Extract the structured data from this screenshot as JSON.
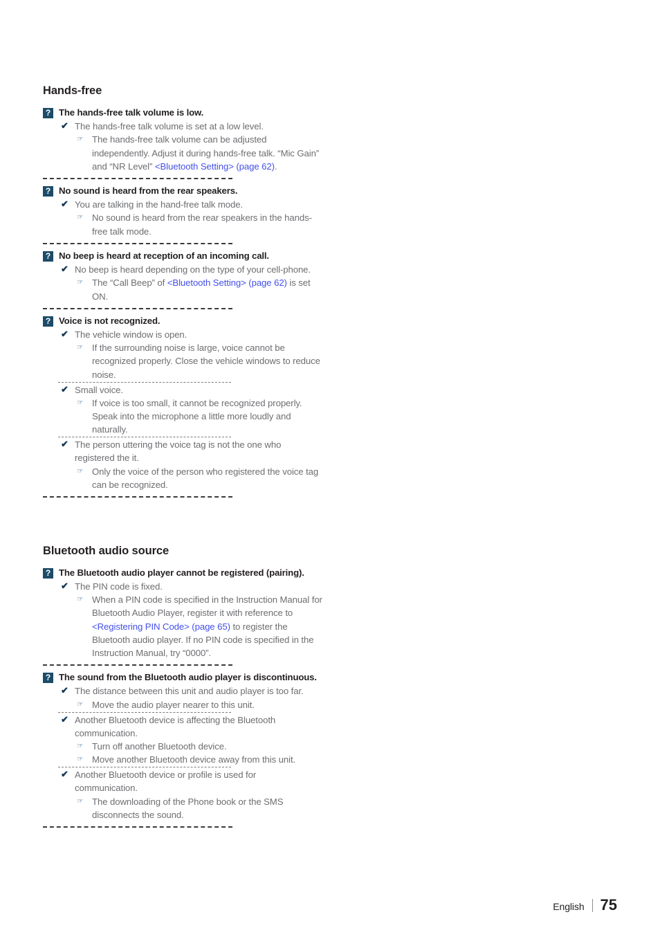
{
  "page": {
    "footer_language": "English",
    "footer_page_number": "75",
    "colors": {
      "badge_bg": "#1c4c68",
      "heading": "#231f20",
      "body": "#6d6e71",
      "link": "#4450e8",
      "check_icon": "#12395a"
    }
  },
  "icons": {
    "question_badge": "?",
    "check": "✔",
    "pointer": "☞"
  },
  "sections": [
    {
      "heading": "Hands-free",
      "items": [
        {
          "question": "The hands-free talk volume is low.",
          "causes": [
            {
              "text": "The hands-free talk volume is set at a low level.",
              "solutions": [
                {
                  "parts": [
                    {
                      "type": "text",
                      "value": "The hands-free talk volume can be adjusted independently. Adjust it during hands-free talk. “Mic Gain” and “NR Level” "
                    },
                    {
                      "type": "link",
                      "value": "<Bluetooth Setting> (page 62)"
                    },
                    {
                      "type": "text",
                      "value": "."
                    }
                  ]
                }
              ]
            }
          ]
        },
        {
          "question": "No sound is heard from the rear speakers.",
          "causes": [
            {
              "text": "You are talking in the hand-free talk mode.",
              "solutions": [
                {
                  "parts": [
                    {
                      "type": "text",
                      "value": "No sound is heard from the rear speakers in the hands-free talk mode."
                    }
                  ]
                }
              ]
            }
          ]
        },
        {
          "question": "No beep is heard at reception of an incoming call.",
          "causes": [
            {
              "text": "No beep is heard depending on the type of your cell-phone.",
              "solutions": [
                {
                  "parts": [
                    {
                      "type": "text",
                      "value": "The “Call Beep” of "
                    },
                    {
                      "type": "link",
                      "value": "<Bluetooth Setting> (page 62)"
                    },
                    {
                      "type": "text",
                      "value": " is set ON."
                    }
                  ]
                }
              ]
            }
          ]
        },
        {
          "question": "Voice is not recognized.",
          "causes": [
            {
              "text": "The vehicle window is open.",
              "solutions": [
                {
                  "parts": [
                    {
                      "type": "text",
                      "value": "If the surrounding noise is large, voice cannot be recognized properly. Close the vehicle windows to reduce noise."
                    }
                  ]
                }
              ]
            },
            {
              "text": "Small voice.",
              "solutions": [
                {
                  "parts": [
                    {
                      "type": "text",
                      "value": "If voice is too small, it cannot be recognized properly. Speak into the microphone a little more loudly and naturally."
                    }
                  ]
                }
              ]
            },
            {
              "text": "The person uttering the voice tag is not the one who registered the it.",
              "solutions": [
                {
                  "parts": [
                    {
                      "type": "text",
                      "value": "Only the voice of the person who registered the voice tag can be recognized."
                    }
                  ]
                }
              ]
            }
          ]
        }
      ]
    },
    {
      "heading": "Bluetooth audio source",
      "items": [
        {
          "question": "The Bluetooth audio player cannot be registered (pairing).",
          "causes": [
            {
              "text": "The PIN code is fixed.",
              "solutions": [
                {
                  "parts": [
                    {
                      "type": "text",
                      "value": "When a PIN code is specified in the Instruction Manual for Bluetooth Audio Player, register it with reference to "
                    },
                    {
                      "type": "link",
                      "value": "<Registering PIN Code> (page 65)"
                    },
                    {
                      "type": "text",
                      "value": " to register the Bluetooth audio player. If no PIN code is specified in the Instruction Manual, try “0000”."
                    }
                  ]
                }
              ]
            }
          ]
        },
        {
          "question": "The sound from the Bluetooth audio player is discontinuous.",
          "causes": [
            {
              "text": "The distance between this unit and audio player is too far.",
              "solutions": [
                {
                  "parts": [
                    {
                      "type": "text",
                      "value": "Move the audio player nearer to this unit."
                    }
                  ]
                }
              ]
            },
            {
              "text": "Another Bluetooth device is affecting the Bluetooth communication.",
              "solutions": [
                {
                  "parts": [
                    {
                      "type": "text",
                      "value": "Turn off another Bluetooth device."
                    }
                  ]
                },
                {
                  "parts": [
                    {
                      "type": "text",
                      "value": "Move another Bluetooth device away from this unit."
                    }
                  ]
                }
              ]
            },
            {
              "text": "Another Bluetooth device or profile is used for communication.",
              "solutions": [
                {
                  "parts": [
                    {
                      "type": "text",
                      "value": "The downloading of the Phone book or the SMS disconnects the sound."
                    }
                  ]
                }
              ]
            }
          ]
        }
      ]
    }
  ]
}
